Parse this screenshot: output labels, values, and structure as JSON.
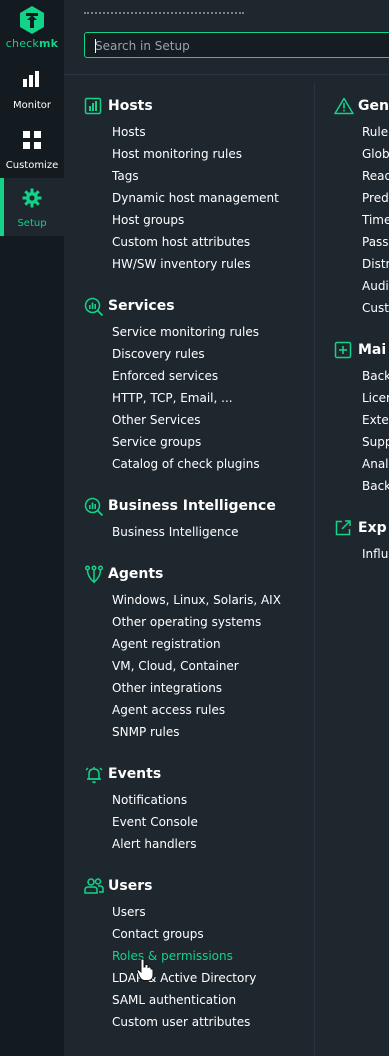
{
  "app": {
    "logo_text_1": "check",
    "logo_text_2": "mk"
  },
  "nav": [
    {
      "label": "Monitor",
      "icon": "monitor-icon"
    },
    {
      "label": "Customize",
      "icon": "customize-icon"
    },
    {
      "label": "Setup",
      "icon": "setup-gear-icon",
      "active": true
    }
  ],
  "search": {
    "placeholder": "Search in Setup",
    "value": ""
  },
  "topics_left": [
    {
      "title": "Hosts",
      "icon": "hosts-icon",
      "items": [
        "Hosts",
        "Host monitoring rules",
        "Tags",
        "Dynamic host management",
        "Host groups",
        "Custom host attributes",
        "HW/SW inventory rules"
      ]
    },
    {
      "title": "Services",
      "icon": "services-icon",
      "items": [
        "Service monitoring rules",
        "Discovery rules",
        "Enforced services",
        "HTTP, TCP, Email, ...",
        "Other Services",
        "Service groups",
        "Catalog of check plugins"
      ]
    },
    {
      "title": "Business Intelligence",
      "icon": "business-intelligence-icon",
      "items": [
        "Business Intelligence"
      ]
    },
    {
      "title": "Agents",
      "icon": "agents-icon",
      "items": [
        "Windows, Linux, Solaris, AIX",
        "Other operating systems",
        "Agent registration",
        "VM, Cloud, Container",
        "Other integrations",
        "Agent access rules",
        "SNMP rules"
      ]
    },
    {
      "title": "Events",
      "icon": "events-bell-icon",
      "items": [
        "Notifications",
        "Event Console",
        "Alert handlers"
      ]
    },
    {
      "title": "Users",
      "icon": "users-icon",
      "items": [
        "Users",
        "Contact groups",
        "Roles & permissions",
        "LDAP & Active Directory",
        "SAML authentication",
        "Custom user attributes"
      ],
      "highlighted": "Roles & permissions"
    }
  ],
  "topics_right": [
    {
      "title": "Gene",
      "icon": "general-warning-icon",
      "items": [
        "Rule",
        "Glob",
        "Read",
        "Pred",
        "Time",
        "Pass",
        "Distr",
        "Audi",
        "Cust"
      ]
    },
    {
      "title": "Mai",
      "icon": "maintenance-plus-icon",
      "items": [
        "Back",
        "Licer",
        "Exter",
        "Supp",
        "Analy",
        "Back"
      ]
    },
    {
      "title": "Exp",
      "icon": "exporter-icon",
      "items": [
        "Influ"
      ]
    }
  ],
  "colors": {
    "accent": "#13d389",
    "rail_bg": "#131a20",
    "panel_bg": "#1e262e"
  }
}
